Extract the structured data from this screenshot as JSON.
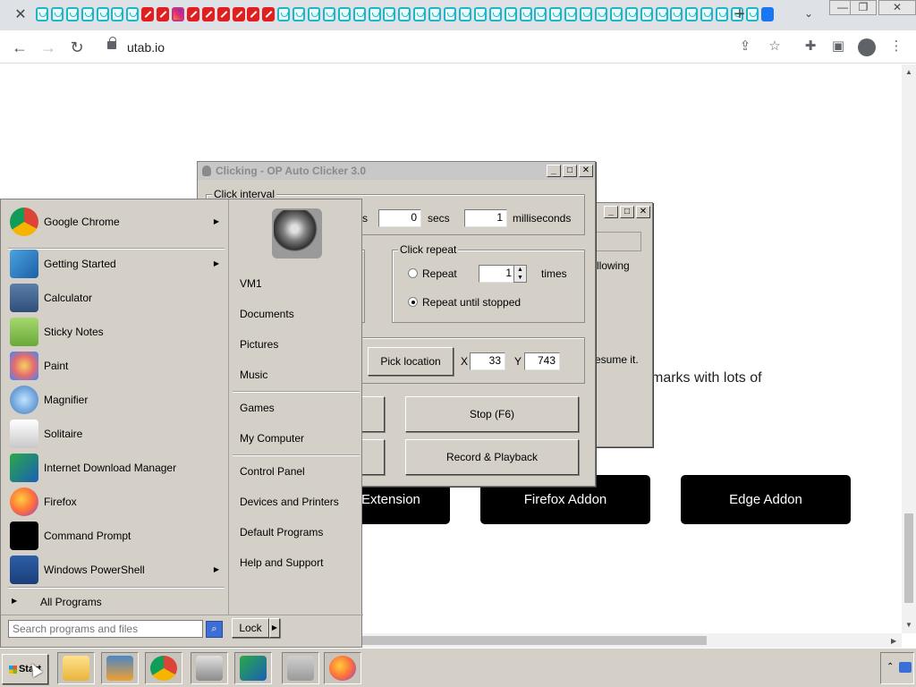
{
  "browser": {
    "url": "utab.io",
    "new_tab_label": "+",
    "tab_icons": [
      "teal",
      "teal",
      "teal",
      "teal",
      "teal",
      "teal",
      "teal",
      "red",
      "red",
      "insta",
      "red",
      "red",
      "red",
      "red",
      "red",
      "red",
      "teal",
      "teal",
      "teal",
      "teal",
      "teal",
      "teal",
      "teal",
      "teal",
      "teal",
      "teal",
      "teal",
      "teal",
      "teal",
      "teal",
      "teal",
      "teal",
      "teal",
      "teal",
      "teal",
      "teal",
      "teal",
      "teal",
      "teal",
      "teal",
      "teal",
      "teal",
      "teal",
      "teal",
      "teal",
      "teal",
      "teal",
      "teal",
      "fb"
    ]
  },
  "page": {
    "partial_text": "marks with lots of",
    "buttons": {
      "chrome_extension": "Extension",
      "firefox_addon": "Firefox Addon",
      "edge_addon": "Edge Addon"
    }
  },
  "back_dialog": {
    "text_allowing": "llowing",
    "text_resume": "esume it."
  },
  "auto_clicker": {
    "title": "Clicking - OP Auto Clicker 3.0",
    "click_interval": {
      "label": "Click interval",
      "secs_unit_partial": "s",
      "secs_value": "0",
      "secs_label": "secs",
      "ms_value": "1",
      "ms_label": "milliseconds"
    },
    "click_repeat": {
      "label": "Click repeat",
      "repeat_label": "Repeat",
      "repeat_times": "1",
      "times_label": "times",
      "until_stopped_label": "Repeat until stopped"
    },
    "cursor_position": {
      "pick_location": "Pick location",
      "x_label": "X",
      "x_value": "33",
      "y_label": "Y",
      "y_value": "743"
    },
    "stop_button": "Stop (F6)",
    "record_button": "Record & Playback"
  },
  "start_menu": {
    "programs": [
      {
        "label": "Google Chrome",
        "icon": "chrome-icon",
        "submenu": true
      },
      {
        "label": "Getting Started",
        "icon": "getting-started-icon",
        "submenu": true
      },
      {
        "label": "Calculator",
        "icon": "calculator-icon",
        "submenu": false
      },
      {
        "label": "Sticky Notes",
        "icon": "sticky-notes-icon",
        "submenu": false
      },
      {
        "label": "Paint",
        "icon": "paint-icon",
        "submenu": false
      },
      {
        "label": "Magnifier",
        "icon": "magnifier-icon",
        "submenu": false
      },
      {
        "label": "Solitaire",
        "icon": "solitaire-icon",
        "submenu": false
      },
      {
        "label": "Internet Download Manager",
        "icon": "idm-icon",
        "submenu": false
      },
      {
        "label": "Firefox",
        "icon": "firefox-icon",
        "submenu": false
      },
      {
        "label": "Command Prompt",
        "icon": "cmd-icon",
        "submenu": false
      },
      {
        "label": "Windows PowerShell",
        "icon": "powershell-icon",
        "submenu": true
      }
    ],
    "all_programs": "All Programs",
    "right_items_1": [
      "VM1",
      "Documents",
      "Pictures",
      "Music"
    ],
    "right_items_2": [
      "Games",
      "My Computer"
    ],
    "right_items_3": [
      "Control Panel",
      "Devices and Printers",
      "Default Programs",
      "Help and Support"
    ],
    "search_placeholder": "Search programs and files",
    "lock_label": "Lock"
  },
  "taskbar": {
    "start_label": "Start",
    "apps": [
      "explorer-icon",
      "media-player-icon",
      "chrome-icon",
      "server-manager-icon",
      "idm-icon",
      "mouse-icon",
      "firefox-icon"
    ]
  },
  "colors": {
    "classic_gray": "#d4d0c8",
    "page_button_bg": "#000000"
  }
}
